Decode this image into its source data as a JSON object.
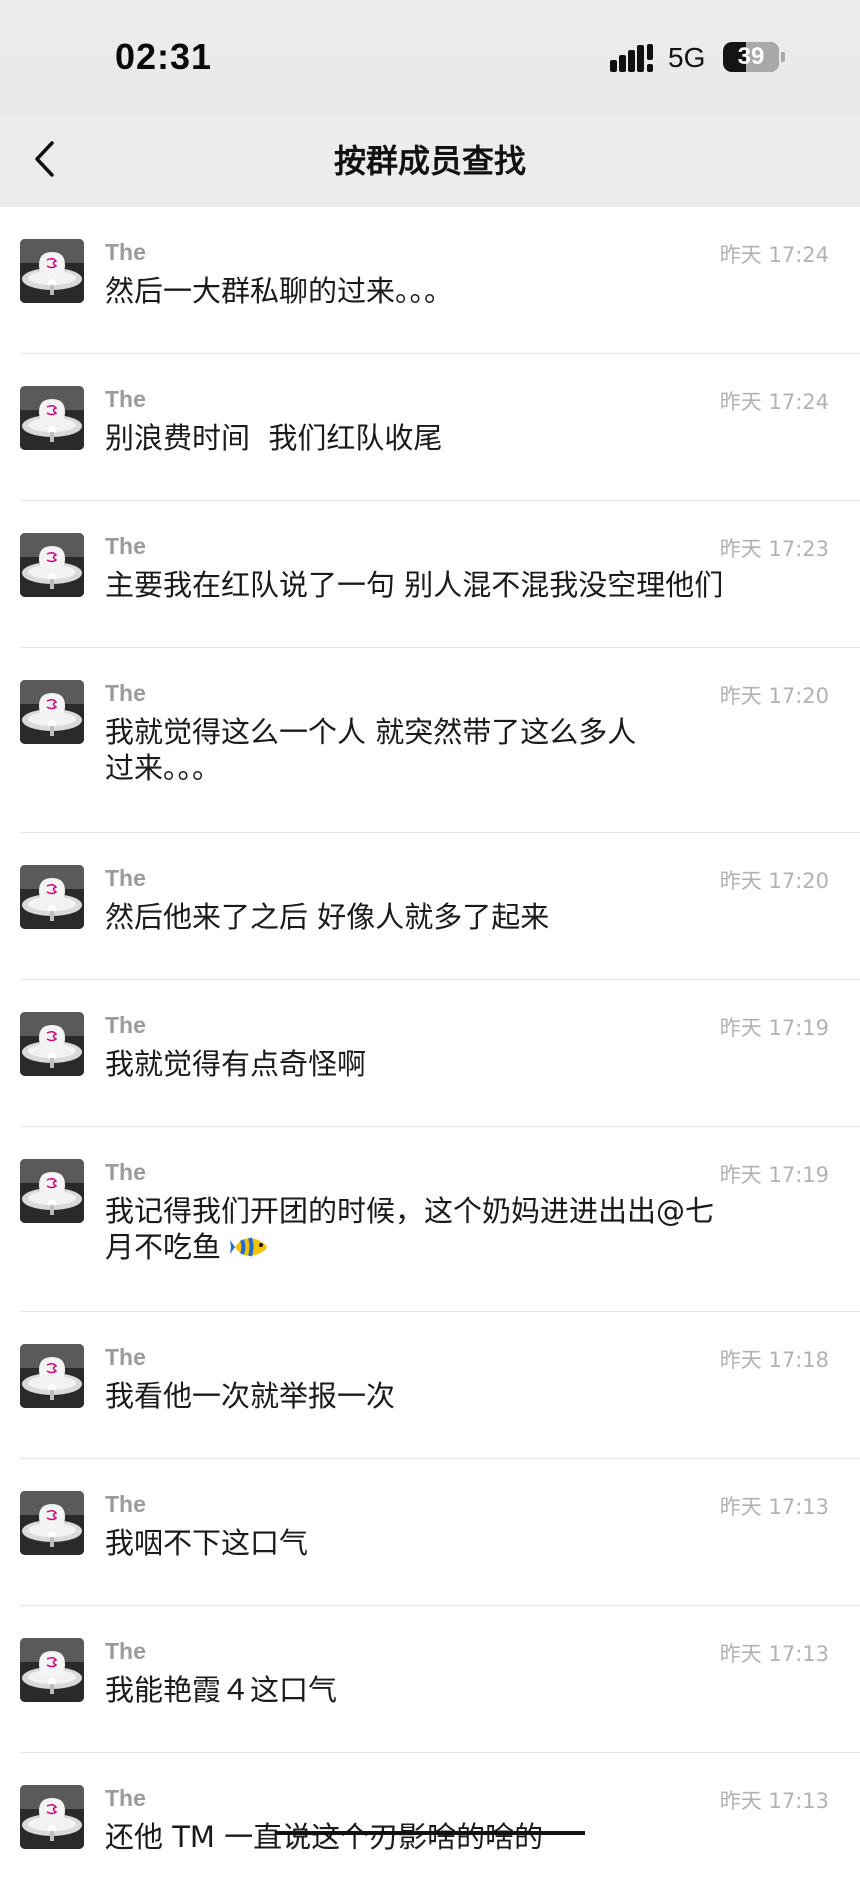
{
  "status_bar": {
    "time": "02:31",
    "network": "5G",
    "battery": "39"
  },
  "nav": {
    "title": "按群成员查找"
  },
  "messages": [
    {
      "sender": "The",
      "time": "昨天 17:24",
      "text": "然后一大群私聊的过来。。。"
    },
    {
      "sender": "The",
      "time": "昨天 17:24",
      "text": "别浪费时间  我们红队收尾"
    },
    {
      "sender": "The",
      "time": "昨天 17:23",
      "text": "主要我在红队说了一句 别人混不混我没空理他们"
    },
    {
      "sender": "The",
      "time": "昨天 17:20",
      "text_line1": "我就觉得这么一个人 就突然带了这么多人",
      "text_line2": "过来。。。"
    },
    {
      "sender": "The",
      "time": "昨天 17:20",
      "text": "然后他来了之后 好像人就多了起来"
    },
    {
      "sender": "The",
      "time": "昨天 17:19",
      "text": "我就觉得有点奇怪啊"
    },
    {
      "sender": "The",
      "time": "昨天 17:19",
      "text_line1": "我记得我们开团的时候，这个奶妈进进出出@七",
      "text_line2": "月不吃鱼"
    },
    {
      "sender": "The",
      "time": "昨天 17:18",
      "text": "我看他一次就举报一次"
    },
    {
      "sender": "The",
      "time": "昨天 17:13",
      "text": "我咽不下这口气"
    },
    {
      "sender": "The",
      "time": "昨天 17:13",
      "text": "我能艳霞４这口气"
    },
    {
      "sender": "The",
      "time": "昨天 17:13",
      "text": "还他 TM 一直说这个刃影啥的啥的"
    }
  ],
  "icons": {
    "back": "chevron-left-icon",
    "signal": "cellular-signal-icon",
    "battery": "battery-icon",
    "avatar": "avatar-image",
    "emoji": "tropical-fish-emoji"
  },
  "colors": {
    "header_bg": "#ececec",
    "name": "#9b9b9b",
    "time": "#b2b2b2",
    "text": "#1a1a1a",
    "divider": "#e6e6e6"
  }
}
